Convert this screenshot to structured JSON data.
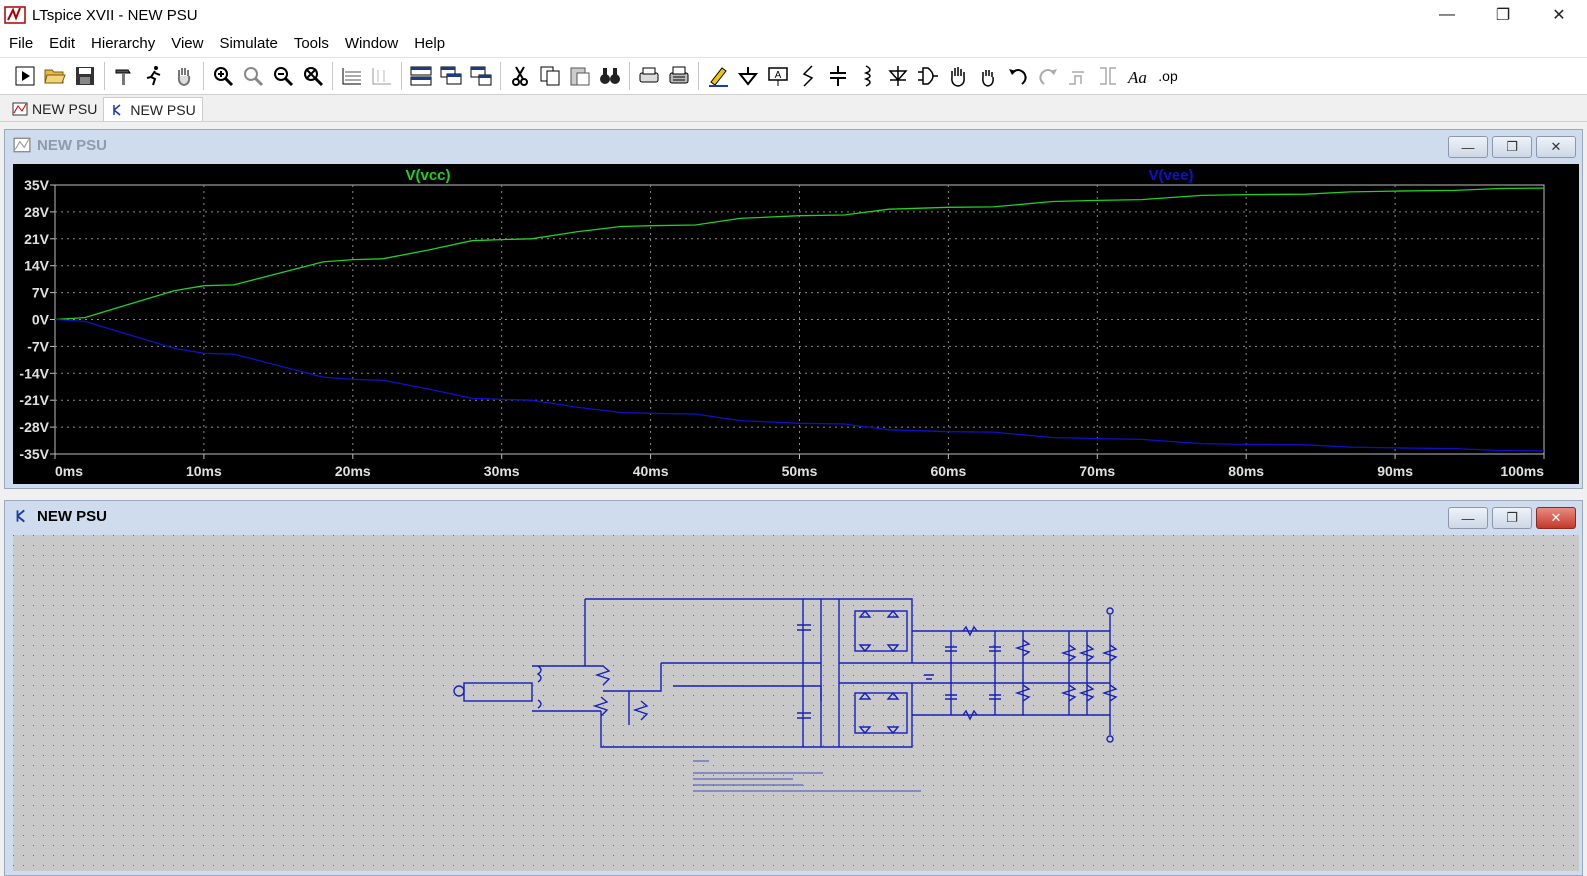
{
  "window": {
    "title": "LTspice XVII - NEW PSU",
    "controls": [
      "—",
      "❐",
      "✕"
    ]
  },
  "menu": [
    {
      "label": "File"
    },
    {
      "label": "Edit"
    },
    {
      "label": "Hierarchy"
    },
    {
      "label": "View"
    },
    {
      "label": "Simulate"
    },
    {
      "label": "Tools"
    },
    {
      "label": "Window"
    },
    {
      "label": "Help"
    }
  ],
  "toolbar": {
    "icons": [
      "run",
      "open",
      "save",
      "control-panel",
      "run-sim",
      "pan",
      "zoom-in",
      "zoom-fit",
      "zoom-out",
      "zoom-cancel",
      "autorange",
      "mark",
      "tile-horizontal",
      "cascade",
      "tile-vertical",
      "cut",
      "copy",
      "paste",
      "find",
      "print-setup",
      "print",
      "draw-wire",
      "ground",
      "label",
      "resistor",
      "capacitor",
      "inductor",
      "diode",
      "component",
      "move",
      "drag",
      "undo",
      "redo",
      "rotate",
      "mirror",
      "text",
      "spice-directive"
    ],
    "spice_directive_label": ".op"
  },
  "tabs": [
    {
      "label": "NEW PSU",
      "icon": "waveform-icon",
      "active": false
    },
    {
      "label": "NEW PSU",
      "icon": "schematic-icon",
      "active": true
    }
  ],
  "waveform_window": {
    "title": "NEW PSU",
    "traces": [
      {
        "name": "V(vcc)",
        "color": "#22d022"
      },
      {
        "name": "V(vee)",
        "color": "#1010c8"
      }
    ]
  },
  "schematic_window": {
    "title": "NEW PSU"
  },
  "chart_data": {
    "type": "line",
    "title": "",
    "xlabel": "",
    "ylabel": "",
    "x_ticks": [
      "0ms",
      "10ms",
      "20ms",
      "30ms",
      "40ms",
      "50ms",
      "60ms",
      "70ms",
      "80ms",
      "90ms",
      "100ms"
    ],
    "y_ticks": [
      "35V",
      "28V",
      "21V",
      "14V",
      "7V",
      "0V",
      "-7V",
      "-14V",
      "-21V",
      "-28V",
      "-35V"
    ],
    "xlim": [
      0,
      100
    ],
    "ylim": [
      -35,
      35
    ],
    "grid": true,
    "series": [
      {
        "name": "V(vcc)",
        "color": "#22d022",
        "x": [
          0,
          2,
          5,
          8,
          10,
          12,
          15,
          18,
          20,
          22,
          25,
          28,
          30,
          32,
          35,
          38,
          40,
          43,
          46,
          50,
          53,
          56,
          60,
          63,
          67,
          70,
          73,
          77,
          80,
          84,
          87,
          90,
          94,
          97,
          100
        ],
        "y": [
          0,
          0.5,
          4,
          7.5,
          8.8,
          9,
          12,
          15,
          15.6,
          15.8,
          18,
          20.5,
          20.8,
          21,
          22.8,
          24.2,
          24.4,
          24.6,
          26.3,
          27,
          27.2,
          28.7,
          29.2,
          29.3,
          30.7,
          31,
          31.2,
          32.3,
          32.5,
          32.6,
          33.2,
          33.4,
          33.6,
          34.1,
          34.2
        ]
      },
      {
        "name": "V(vee)",
        "color": "#1010c8",
        "x": [
          0,
          2,
          5,
          8,
          10,
          12,
          15,
          18,
          20,
          22,
          25,
          28,
          30,
          32,
          35,
          38,
          40,
          43,
          46,
          50,
          53,
          56,
          60,
          63,
          67,
          70,
          73,
          77,
          80,
          84,
          87,
          90,
          94,
          97,
          100
        ],
        "y": [
          0,
          -0.5,
          -4,
          -7.5,
          -8.8,
          -9,
          -12,
          -15,
          -15.6,
          -15.8,
          -18,
          -20.5,
          -20.8,
          -21,
          -22.8,
          -24.2,
          -24.4,
          -24.6,
          -26.3,
          -27,
          -27.2,
          -28.7,
          -29.2,
          -29.3,
          -30.7,
          -31,
          -31.2,
          -32.3,
          -32.5,
          -32.6,
          -33.2,
          -33.4,
          -33.6,
          -34.1,
          -34.2
        ]
      }
    ]
  }
}
